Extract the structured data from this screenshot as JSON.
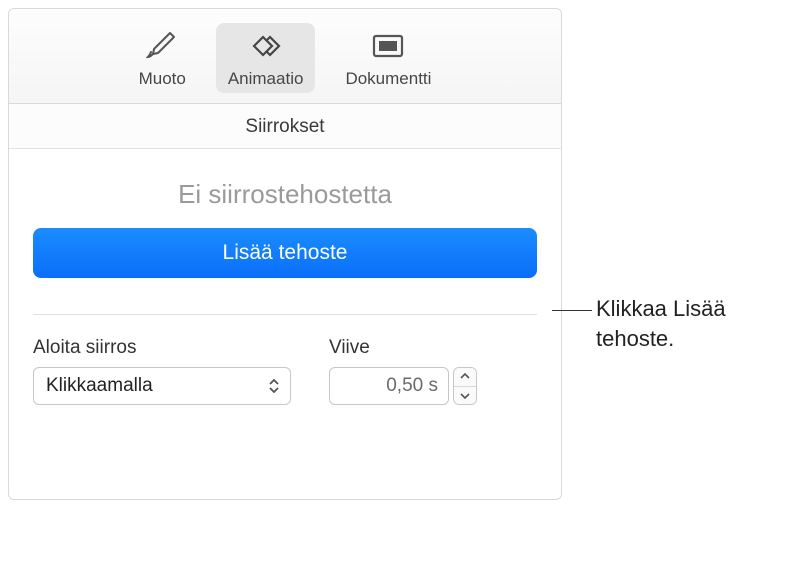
{
  "toolbar": {
    "muoto_label": "Muoto",
    "animaatio_label": "Animaatio",
    "dokumentti_label": "Dokumentti"
  },
  "section_title": "Siirrokset",
  "effect_title": "Ei siirrostehostetta",
  "add_effect_label": "Lisää tehoste",
  "start_transition": {
    "label": "Aloita siirros",
    "value": "Klikkaamalla"
  },
  "delay": {
    "label": "Viive",
    "value": "0,50 s"
  },
  "callout_text": "Klikkaa Lisää tehoste."
}
